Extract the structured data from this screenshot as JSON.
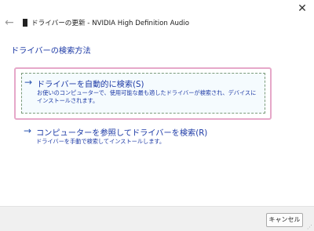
{
  "window": {
    "title": "ドライバーの更新 - NVIDIA High Definition Audio",
    "close_glyph": "✕",
    "back_glyph": "←"
  },
  "main": {
    "heading": "ドライバーの検索方法",
    "options": [
      {
        "arrow": "→",
        "title": "ドライバーを自動的に検索(S)",
        "description": "お使いのコンピューターで、使用可能な最も適したドライバーが検索され、デバイスにインストールされます。"
      },
      {
        "arrow": "→",
        "title": "コンピューターを参照してドライバーを検索(R)",
        "description": "ドライバーを手動で検索してインストールします。"
      }
    ]
  },
  "footer": {
    "cancel_label": "キャンセル"
  },
  "icons": [
    "close-icon",
    "back-arrow-icon",
    "device-icon",
    "arrow-right-icon",
    "resize-grip-icon"
  ],
  "colors": {
    "link_blue": "#1d3aa6",
    "focus_outline": "#e6a8c9"
  }
}
